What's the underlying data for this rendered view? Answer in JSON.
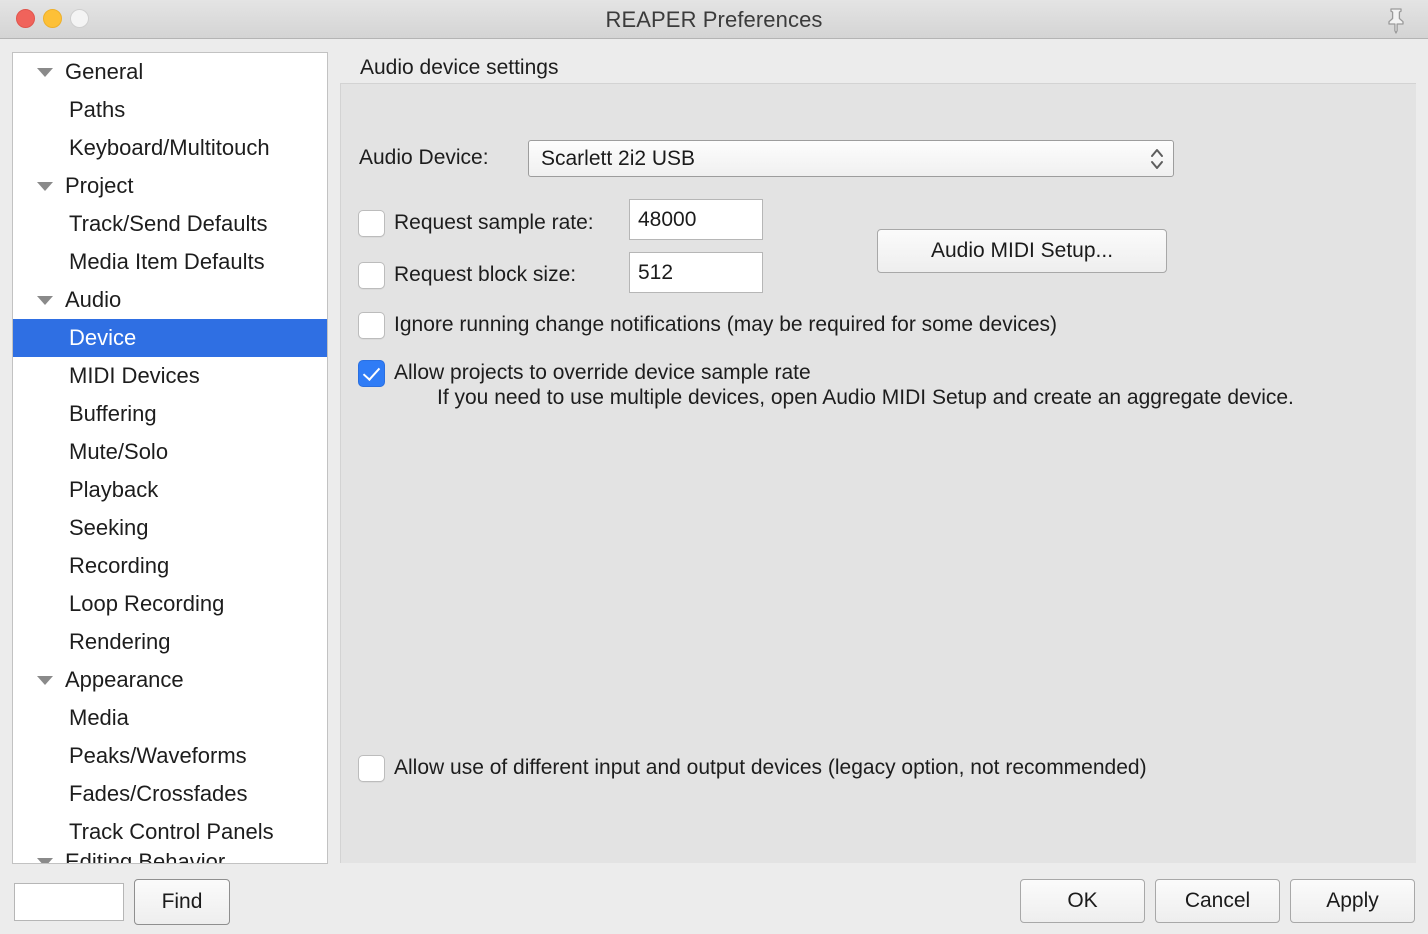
{
  "window": {
    "title": "REAPER Preferences",
    "traffic_lights": [
      "close-button",
      "minimize-button",
      "zoom-button"
    ],
    "pin_icon": "pushpin-icon",
    "accent_color": "#2f6fe3",
    "checkbox_on_color": "#2f7cf6"
  },
  "sidebar": {
    "items": [
      {
        "label": "General",
        "level": 0,
        "expandable": true,
        "selected": false
      },
      {
        "label": "Paths",
        "level": 1,
        "expandable": false,
        "selected": false
      },
      {
        "label": "Keyboard/Multitouch",
        "level": 1,
        "expandable": false,
        "selected": false
      },
      {
        "label": "Project",
        "level": 0,
        "expandable": true,
        "selected": false
      },
      {
        "label": "Track/Send Defaults",
        "level": 1,
        "expandable": false,
        "selected": false
      },
      {
        "label": "Media Item Defaults",
        "level": 1,
        "expandable": false,
        "selected": false
      },
      {
        "label": "Audio",
        "level": 0,
        "expandable": true,
        "selected": false
      },
      {
        "label": "Device",
        "level": 1,
        "expandable": false,
        "selected": true
      },
      {
        "label": "MIDI Devices",
        "level": 1,
        "expandable": false,
        "selected": false
      },
      {
        "label": "Buffering",
        "level": 1,
        "expandable": false,
        "selected": false
      },
      {
        "label": "Mute/Solo",
        "level": 1,
        "expandable": false,
        "selected": false
      },
      {
        "label": "Playback",
        "level": 1,
        "expandable": false,
        "selected": false
      },
      {
        "label": "Seeking",
        "level": 1,
        "expandable": false,
        "selected": false
      },
      {
        "label": "Recording",
        "level": 1,
        "expandable": false,
        "selected": false
      },
      {
        "label": "Loop Recording",
        "level": 1,
        "expandable": false,
        "selected": false
      },
      {
        "label": "Rendering",
        "level": 1,
        "expandable": false,
        "selected": false
      },
      {
        "label": "Appearance",
        "level": 0,
        "expandable": true,
        "selected": false
      },
      {
        "label": "Media",
        "level": 1,
        "expandable": false,
        "selected": false
      },
      {
        "label": "Peaks/Waveforms",
        "level": 1,
        "expandable": false,
        "selected": false
      },
      {
        "label": "Fades/Crossfades",
        "level": 1,
        "expandable": false,
        "selected": false
      },
      {
        "label": "Track Control Panels",
        "level": 1,
        "expandable": false,
        "selected": false
      },
      {
        "label": "Editing Behavior",
        "level": 0,
        "expandable": true,
        "selected": false
      }
    ]
  },
  "main": {
    "section_title": "Audio device settings",
    "device_label": "Audio Device:",
    "device_value": "Scarlett 2i2 USB",
    "sample_rate": {
      "label": "Request sample rate:",
      "checked": false,
      "value": "48000"
    },
    "block_size": {
      "label": "Request block size:",
      "checked": false,
      "value": "512"
    },
    "ignore_notifications": {
      "label": "Ignore running change notifications (may be required for some devices)",
      "checked": false
    },
    "override_sample_rate": {
      "label": "Allow projects to override device sample rate",
      "checked": true
    },
    "helper_text": "If you need to use multiple devices, open Audio MIDI Setup and create an aggregate device.",
    "different_io": {
      "label": "Allow use of different input and output devices (legacy option, not recommended)",
      "checked": false
    },
    "audio_midi_setup_button": "Audio MIDI Setup..."
  },
  "bottom": {
    "find_value": "",
    "find_placeholder": "",
    "find_button": "Find",
    "ok_button": "OK",
    "cancel_button": "Cancel",
    "apply_button": "Apply"
  }
}
